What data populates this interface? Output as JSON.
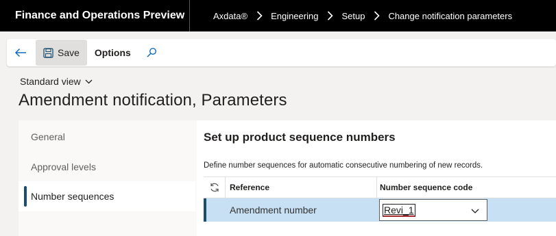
{
  "app": {
    "title": "Finance and Operations Preview"
  },
  "breadcrumb": [
    "Axdata®",
    "Engineering",
    "Setup",
    "Change notification parameters"
  ],
  "icons": {
    "back": "arrow-left-icon",
    "save": "floppy-disk-icon",
    "search": "search-icon",
    "chevron": "chevron-right-icon",
    "refresh": "refresh-icon",
    "dropdown": "chevron-down-icon"
  },
  "colors": {
    "topbar": "#000000",
    "selection": "#c7e0f4",
    "accent": "#1a4e6e"
  },
  "toolbar": {
    "save_label": "Save",
    "options_label": "Options"
  },
  "view": {
    "label": "Standard view"
  },
  "page": {
    "title": "Amendment notification, Parameters"
  },
  "nav": {
    "items": [
      "General",
      "Approval levels",
      "Number sequences"
    ],
    "selected": "Number sequences"
  },
  "section": {
    "title": "Set up product sequence numbers",
    "description": "Define number sequences for automatic consecutive numbering of new records."
  },
  "grid": {
    "columns": [
      "Reference",
      "Number sequence code"
    ],
    "rows": [
      {
        "reference": "Amendment number",
        "code": "Revi_1"
      }
    ]
  }
}
